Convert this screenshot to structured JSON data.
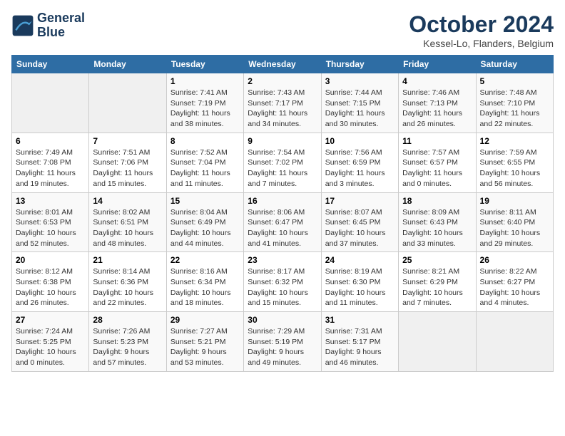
{
  "header": {
    "logo_line1": "General",
    "logo_line2": "Blue",
    "title": "October 2024",
    "location": "Kessel-Lo, Flanders, Belgium"
  },
  "weekdays": [
    "Sunday",
    "Monday",
    "Tuesday",
    "Wednesday",
    "Thursday",
    "Friday",
    "Saturday"
  ],
  "weeks": [
    [
      {
        "day": "",
        "sunrise": "",
        "sunset": "",
        "daylight": ""
      },
      {
        "day": "",
        "sunrise": "",
        "sunset": "",
        "daylight": ""
      },
      {
        "day": "1",
        "sunrise": "Sunrise: 7:41 AM",
        "sunset": "Sunset: 7:19 PM",
        "daylight": "Daylight: 11 hours and 38 minutes."
      },
      {
        "day": "2",
        "sunrise": "Sunrise: 7:43 AM",
        "sunset": "Sunset: 7:17 PM",
        "daylight": "Daylight: 11 hours and 34 minutes."
      },
      {
        "day": "3",
        "sunrise": "Sunrise: 7:44 AM",
        "sunset": "Sunset: 7:15 PM",
        "daylight": "Daylight: 11 hours and 30 minutes."
      },
      {
        "day": "4",
        "sunrise": "Sunrise: 7:46 AM",
        "sunset": "Sunset: 7:13 PM",
        "daylight": "Daylight: 11 hours and 26 minutes."
      },
      {
        "day": "5",
        "sunrise": "Sunrise: 7:48 AM",
        "sunset": "Sunset: 7:10 PM",
        "daylight": "Daylight: 11 hours and 22 minutes."
      }
    ],
    [
      {
        "day": "6",
        "sunrise": "Sunrise: 7:49 AM",
        "sunset": "Sunset: 7:08 PM",
        "daylight": "Daylight: 11 hours and 19 minutes."
      },
      {
        "day": "7",
        "sunrise": "Sunrise: 7:51 AM",
        "sunset": "Sunset: 7:06 PM",
        "daylight": "Daylight: 11 hours and 15 minutes."
      },
      {
        "day": "8",
        "sunrise": "Sunrise: 7:52 AM",
        "sunset": "Sunset: 7:04 PM",
        "daylight": "Daylight: 11 hours and 11 minutes."
      },
      {
        "day": "9",
        "sunrise": "Sunrise: 7:54 AM",
        "sunset": "Sunset: 7:02 PM",
        "daylight": "Daylight: 11 hours and 7 minutes."
      },
      {
        "day": "10",
        "sunrise": "Sunrise: 7:56 AM",
        "sunset": "Sunset: 6:59 PM",
        "daylight": "Daylight: 11 hours and 3 minutes."
      },
      {
        "day": "11",
        "sunrise": "Sunrise: 7:57 AM",
        "sunset": "Sunset: 6:57 PM",
        "daylight": "Daylight: 11 hours and 0 minutes."
      },
      {
        "day": "12",
        "sunrise": "Sunrise: 7:59 AM",
        "sunset": "Sunset: 6:55 PM",
        "daylight": "Daylight: 10 hours and 56 minutes."
      }
    ],
    [
      {
        "day": "13",
        "sunrise": "Sunrise: 8:01 AM",
        "sunset": "Sunset: 6:53 PM",
        "daylight": "Daylight: 10 hours and 52 minutes."
      },
      {
        "day": "14",
        "sunrise": "Sunrise: 8:02 AM",
        "sunset": "Sunset: 6:51 PM",
        "daylight": "Daylight: 10 hours and 48 minutes."
      },
      {
        "day": "15",
        "sunrise": "Sunrise: 8:04 AM",
        "sunset": "Sunset: 6:49 PM",
        "daylight": "Daylight: 10 hours and 44 minutes."
      },
      {
        "day": "16",
        "sunrise": "Sunrise: 8:06 AM",
        "sunset": "Sunset: 6:47 PM",
        "daylight": "Daylight: 10 hours and 41 minutes."
      },
      {
        "day": "17",
        "sunrise": "Sunrise: 8:07 AM",
        "sunset": "Sunset: 6:45 PM",
        "daylight": "Daylight: 10 hours and 37 minutes."
      },
      {
        "day": "18",
        "sunrise": "Sunrise: 8:09 AM",
        "sunset": "Sunset: 6:43 PM",
        "daylight": "Daylight: 10 hours and 33 minutes."
      },
      {
        "day": "19",
        "sunrise": "Sunrise: 8:11 AM",
        "sunset": "Sunset: 6:40 PM",
        "daylight": "Daylight: 10 hours and 29 minutes."
      }
    ],
    [
      {
        "day": "20",
        "sunrise": "Sunrise: 8:12 AM",
        "sunset": "Sunset: 6:38 PM",
        "daylight": "Daylight: 10 hours and 26 minutes."
      },
      {
        "day": "21",
        "sunrise": "Sunrise: 8:14 AM",
        "sunset": "Sunset: 6:36 PM",
        "daylight": "Daylight: 10 hours and 22 minutes."
      },
      {
        "day": "22",
        "sunrise": "Sunrise: 8:16 AM",
        "sunset": "Sunset: 6:34 PM",
        "daylight": "Daylight: 10 hours and 18 minutes."
      },
      {
        "day": "23",
        "sunrise": "Sunrise: 8:17 AM",
        "sunset": "Sunset: 6:32 PM",
        "daylight": "Daylight: 10 hours and 15 minutes."
      },
      {
        "day": "24",
        "sunrise": "Sunrise: 8:19 AM",
        "sunset": "Sunset: 6:30 PM",
        "daylight": "Daylight: 10 hours and 11 minutes."
      },
      {
        "day": "25",
        "sunrise": "Sunrise: 8:21 AM",
        "sunset": "Sunset: 6:29 PM",
        "daylight": "Daylight: 10 hours and 7 minutes."
      },
      {
        "day": "26",
        "sunrise": "Sunrise: 8:22 AM",
        "sunset": "Sunset: 6:27 PM",
        "daylight": "Daylight: 10 hours and 4 minutes."
      }
    ],
    [
      {
        "day": "27",
        "sunrise": "Sunrise: 7:24 AM",
        "sunset": "Sunset: 5:25 PM",
        "daylight": "Daylight: 10 hours and 0 minutes."
      },
      {
        "day": "28",
        "sunrise": "Sunrise: 7:26 AM",
        "sunset": "Sunset: 5:23 PM",
        "daylight": "Daylight: 9 hours and 57 minutes."
      },
      {
        "day": "29",
        "sunrise": "Sunrise: 7:27 AM",
        "sunset": "Sunset: 5:21 PM",
        "daylight": "Daylight: 9 hours and 53 minutes."
      },
      {
        "day": "30",
        "sunrise": "Sunrise: 7:29 AM",
        "sunset": "Sunset: 5:19 PM",
        "daylight": "Daylight: 9 hours and 49 minutes."
      },
      {
        "day": "31",
        "sunrise": "Sunrise: 7:31 AM",
        "sunset": "Sunset: 5:17 PM",
        "daylight": "Daylight: 9 hours and 46 minutes."
      },
      {
        "day": "",
        "sunrise": "",
        "sunset": "",
        "daylight": ""
      },
      {
        "day": "",
        "sunrise": "",
        "sunset": "",
        "daylight": ""
      }
    ]
  ]
}
